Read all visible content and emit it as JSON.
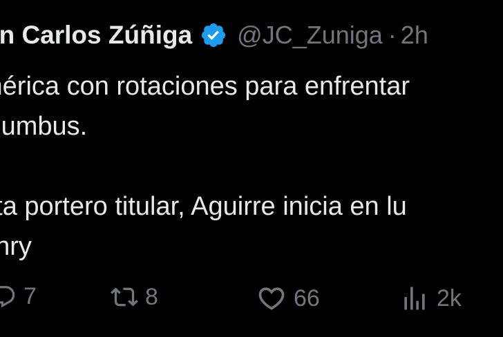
{
  "tweet": {
    "author_name": "an Carlos Zúñiga",
    "handle": "@JC_Zuniga",
    "separator": "·",
    "time": "2h",
    "lines": [
      "mérica con rotaciones para enfrentar",
      "olumbus.",
      "",
      "ota portero titular, Aguirre inicia en lu",
      "enry"
    ]
  },
  "actions": {
    "reply": {
      "icon": "reply-icon",
      "count": "7"
    },
    "retweet": {
      "icon": "retweet-icon",
      "count": "8"
    },
    "like": {
      "icon": "heart-icon",
      "count": "66"
    },
    "views": {
      "icon": "analytics-icon",
      "count": "2k"
    }
  },
  "colors": {
    "background": "#000000",
    "text": "#e7e9ea",
    "muted": "#71767b",
    "verified": "#1d9bf0"
  }
}
